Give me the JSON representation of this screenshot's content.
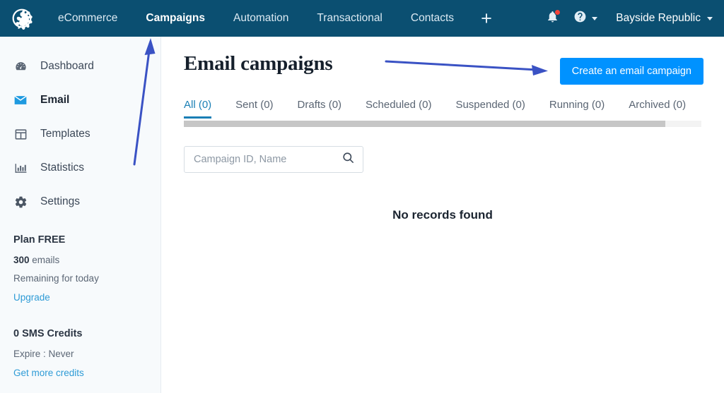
{
  "topnav": {
    "logo_icon": "brevo-pinwheel-logo",
    "items": [
      {
        "label": "eCommerce",
        "active": false
      },
      {
        "label": "Campaigns",
        "active": true
      },
      {
        "label": "Automation",
        "active": false
      },
      {
        "label": "Transactional",
        "active": false
      },
      {
        "label": "Contacts",
        "active": false
      }
    ],
    "plus_label": "+",
    "notification_icon": "bell-icon",
    "notification_badge": true,
    "help_icon": "question-circle-icon",
    "account_label": "Bayside Republic"
  },
  "sidebar": {
    "items": [
      {
        "label": "Dashboard",
        "icon": "gauge-icon",
        "active": false
      },
      {
        "label": "Email",
        "icon": "envelope-icon",
        "active": true
      },
      {
        "label": "Templates",
        "icon": "layout-icon",
        "active": false
      },
      {
        "label": "Statistics",
        "icon": "bar-chart-icon",
        "active": false
      },
      {
        "label": "Settings",
        "icon": "gear-icon",
        "active": false
      }
    ],
    "plan": {
      "title": "Plan FREE",
      "quota_value": "300",
      "quota_unit": " emails",
      "quota_note": "Remaining for today",
      "upgrade_link": "Upgrade"
    },
    "sms": {
      "title": "0 SMS Credits",
      "expire": "Expire : Never",
      "link": "Get more credits"
    }
  },
  "main": {
    "page_title": "Email campaigns",
    "create_button": "Create an email campaign",
    "tabs": [
      {
        "label": "All (0)",
        "active": true
      },
      {
        "label": "Sent (0)",
        "active": false
      },
      {
        "label": "Drafts (0)",
        "active": false
      },
      {
        "label": "Scheduled (0)",
        "active": false
      },
      {
        "label": "Suspended (0)",
        "active": false
      },
      {
        "label": "Running (0)",
        "active": false
      },
      {
        "label": "Archived (0)",
        "active": false
      }
    ],
    "search_placeholder": "Campaign ID, Name",
    "search_value": "",
    "search_icon": "search-icon",
    "empty_message": "No records found"
  },
  "annotations": {
    "arrow_to_campaigns_tab": "vertical-arrow-pointing-to-campaigns-nav",
    "arrow_to_create_button": "horizontal-arrow-pointing-to-create-button",
    "arrow_color": "#3a52c4"
  },
  "colors": {
    "header_bg": "#0b4f71",
    "sidebar_bg": "#f7fafc",
    "accent_button": "#0092ff",
    "active_tab": "#1a7fb5",
    "link": "#2e9bd6"
  }
}
